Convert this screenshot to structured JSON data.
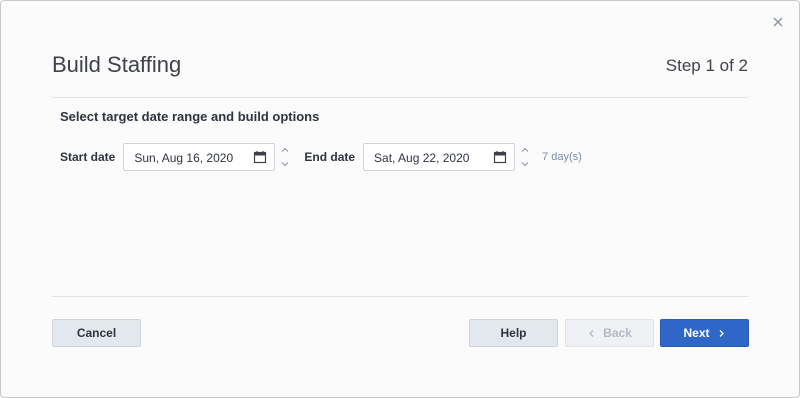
{
  "dialog": {
    "title": "Build Staffing",
    "step": "Step 1 of 2",
    "subtitle": "Select target date range and build options"
  },
  "start_date": {
    "label": "Start date",
    "value": "Sun, Aug 16, 2020"
  },
  "end_date": {
    "label": "End date",
    "value": "Sat, Aug 22, 2020"
  },
  "duration": "7 day(s)",
  "buttons": {
    "cancel": "Cancel",
    "help": "Help",
    "back": "Back",
    "next": "Next"
  },
  "icons": {
    "close": "close-icon",
    "calendar": "calendar-icon",
    "up": "chevron-up-icon",
    "down": "chevron-down-icon",
    "back": "chevron-left-icon",
    "next": "chevron-right-icon"
  },
  "colors": {
    "primary": "#2f66c8",
    "secondary_button": "#e3e7ee",
    "disabled_button": "#eff1f4",
    "muted_text": "#7d8aa8"
  }
}
